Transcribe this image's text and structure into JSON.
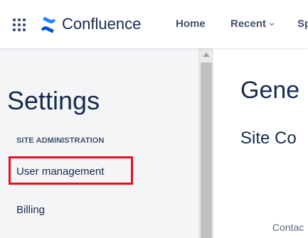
{
  "header": {
    "app_name": "Confluence",
    "nav": {
      "home": "Home",
      "recent": "Recent",
      "spaces": "Sp"
    },
    "icons": {
      "app_switcher": "grid-icon",
      "logo": "confluence-logo-icon",
      "recent_chevron": "chevron-down-icon"
    },
    "colors": {
      "brand": "#0052cc",
      "brand_light": "#2684ff"
    }
  },
  "sidebar": {
    "title": "Settings",
    "section_heading": "SITE ADMINISTRATION",
    "items": [
      {
        "label": "User management",
        "highlighted": true
      },
      {
        "label": "Billing",
        "highlighted": false
      }
    ],
    "highlight_color": "#e8101c"
  },
  "main": {
    "page_title": "Gene",
    "section_title": "Site Co",
    "field_label": "Contac"
  }
}
